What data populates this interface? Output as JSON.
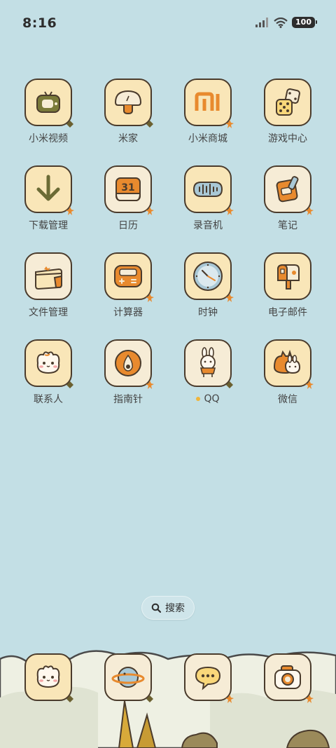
{
  "status_bar": {
    "time": "8:16",
    "battery": "100",
    "icons": [
      "signal-icon",
      "wifi-icon",
      "battery-icon"
    ]
  },
  "apps": [
    {
      "label": "小米视频",
      "icon": "tv-icon"
    },
    {
      "label": "米家",
      "icon": "mushroom-icon"
    },
    {
      "label": "小米商城",
      "icon": "mi-logo-icon"
    },
    {
      "label": "游戏中心",
      "icon": "dice-icon"
    },
    {
      "label": "下载管理",
      "icon": "download-arrow-icon"
    },
    {
      "label": "日历",
      "icon": "calendar-icon",
      "date": "31"
    },
    {
      "label": "录音机",
      "icon": "sound-wave-icon"
    },
    {
      "label": "笔记",
      "icon": "notepad-icon"
    },
    {
      "label": "文件管理",
      "icon": "folder-bag-icon"
    },
    {
      "label": "计算器",
      "icon": "calculator-icon"
    },
    {
      "label": "时钟",
      "icon": "clock-icon"
    },
    {
      "label": "电子邮件",
      "icon": "mailbox-icon"
    },
    {
      "label": "联系人",
      "icon": "bunny-face-icon"
    },
    {
      "label": "指南针",
      "icon": "compass-icon"
    },
    {
      "label": "QQ",
      "icon": "bunny-character-icon",
      "has_new_dot": true
    },
    {
      "label": "微信",
      "icon": "cat-bunny-icon"
    }
  ],
  "search": {
    "label": "搜索",
    "icon": "search-icon"
  },
  "dock": [
    {
      "icon": "bunny-face-icon"
    },
    {
      "icon": "planet-icon"
    },
    {
      "icon": "chat-bubble-icon"
    },
    {
      "icon": "camera-icon"
    }
  ],
  "colors": {
    "background": "#c3dfe5",
    "tile": "#f9e6b8",
    "outline": "#4a3b2c",
    "accent_orange": "#e88a2e",
    "dot_yellow": "#f0b53a"
  }
}
